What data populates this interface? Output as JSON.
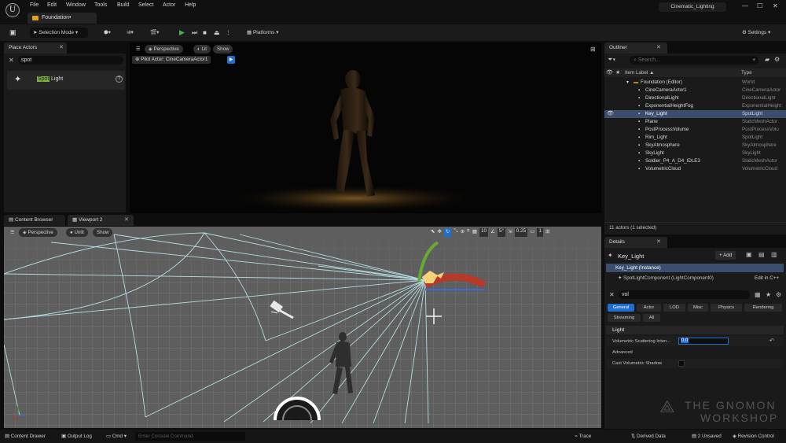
{
  "menu": [
    "File",
    "Edit",
    "Window",
    "Tools",
    "Build",
    "Select",
    "Actor",
    "Help"
  ],
  "document_tab": "Foundation•",
  "project_name": "Cinematic_Lighting",
  "toolbar": {
    "mode": "Selection Mode",
    "platforms": "Platforms",
    "settings": "Settings"
  },
  "place_actors": {
    "tab": "Place Actors",
    "search_value": "spot",
    "result_label": "Light",
    "result_highlight": "Spot"
  },
  "viewport1": {
    "perspective": "Perspective",
    "lit": "Lit",
    "show": "Show",
    "pilot": "Pilot Actor: CineCameraActor1"
  },
  "bottom_tabs": {
    "content_browser": "Content Browser",
    "viewport2": "Viewport 2"
  },
  "viewport2": {
    "perspective": "Perspective",
    "unlit": "Unlit",
    "show": "Show",
    "grid_snap": "10",
    "rot_snap": "5°",
    "scale_snap": "0.25",
    "cam_speed": "1"
  },
  "outliner": {
    "tab": "Outliner",
    "search_placeholder": "Search...",
    "col_label": "Item Label ▲",
    "col_type": "Type",
    "rows": [
      {
        "label": "Foundation (Editor)",
        "type": "World"
      },
      {
        "label": "CineCameraActor1",
        "type": "CineCameraActor"
      },
      {
        "label": "DirectionalLight",
        "type": "DirectionalLight"
      },
      {
        "label": "ExponentialHeightFog",
        "type": "ExponentialHeight"
      },
      {
        "label": "Key_Light",
        "type": "SpotLight"
      },
      {
        "label": "Plane",
        "type": "StaticMeshActor"
      },
      {
        "label": "PostProcessVolume",
        "type": "PostProcessVolu"
      },
      {
        "label": "Rim_Light",
        "type": "SpotLight"
      },
      {
        "label": "SkyAtmosphere",
        "type": "SkyAtmosphere"
      },
      {
        "label": "SkyLight",
        "type": "SkyLight"
      },
      {
        "label": "Soldier_P4_A_D4_IDLE3",
        "type": "StaticMeshActor"
      },
      {
        "label": "VolumetricCloud",
        "type": "VolumetricCloud"
      }
    ],
    "footer": "11 actors (1 selected)"
  },
  "details": {
    "tab": "Details",
    "actor_name": "Key_Light",
    "add": "+ Add",
    "instance": "Key_Light (Instance)",
    "component": "SpotLightComponent (LightComponent0)",
    "edit_cpp": "Edit in C++",
    "search_value": "vol",
    "filter_tabs": [
      "General",
      "Actor",
      "LOD",
      "Misc",
      "Physics",
      "Rendering"
    ],
    "filter_tabs2": [
      "Streaming",
      "All"
    ],
    "section_light": "Light",
    "prop_vol_label": "Volumetric Scattering Inten...",
    "prop_vol_value": "0.0",
    "section_advanced": "Advanced",
    "prop_cast_label": "Cast Volumetric Shadow"
  },
  "statusbar": {
    "content_drawer": "Content Drawer",
    "output_log": "Output Log",
    "cmd": "Cmd",
    "console_placeholder": "Enter Console Command",
    "trace": "Trace",
    "derived_data": "Derived Data",
    "unsaved": "2 Unsaved",
    "revision": "Revision Control"
  },
  "watermark": {
    "line1": "THE GNOMON",
    "line2": "WORKSHOP"
  },
  "colors": {
    "accent_blue": "#1f6fd1",
    "selected_row": "#3b4e6e",
    "play_green": "#4caf50"
  }
}
